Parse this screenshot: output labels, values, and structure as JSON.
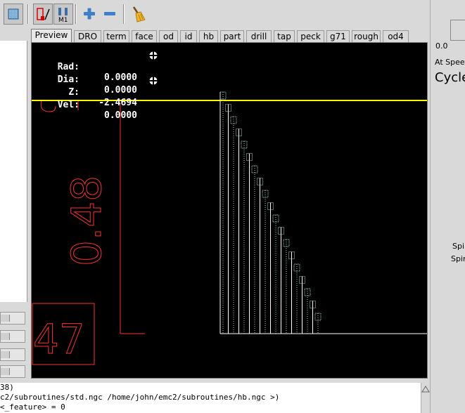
{
  "toolbar": {
    "buttons": [
      {
        "name": "estop-toggle",
        "icon": "estop-square-icon"
      },
      {
        "name": "optional-stop",
        "icon": "optional-stop-icon"
      },
      {
        "name": "machine-stop",
        "icon": "m1-icon",
        "label": "M1"
      },
      {
        "name": "zoom-in",
        "icon": "plus-icon"
      },
      {
        "name": "zoom-out",
        "icon": "minus-icon"
      },
      {
        "name": "clear-plot",
        "icon": "broom-icon"
      }
    ]
  },
  "tabs": [
    {
      "label": "Preview",
      "active": true
    },
    {
      "label": "DRO"
    },
    {
      "label": "term"
    },
    {
      "label": "face"
    },
    {
      "label": "od"
    },
    {
      "label": "id"
    },
    {
      "label": "hb"
    },
    {
      "label": "part"
    },
    {
      "label": "drill"
    },
    {
      "label": "tap"
    },
    {
      "label": "peck"
    },
    {
      "label": "g71"
    },
    {
      "label": "rough"
    },
    {
      "label": "od4"
    }
  ],
  "dro": [
    {
      "label": "Rad:",
      "value": "0.0000",
      "homed": true
    },
    {
      "label": "Dia:",
      "value": "0.0000",
      "homed": false
    },
    {
      "label": "Z:",
      "value": "-2.4694",
      "homed": true
    },
    {
      "label": "Vel:",
      "value": "0.0000",
      "homed": false
    }
  ],
  "preview": {
    "dimension_text": "0.48",
    "partial_dimension_text": "47",
    "colors": {
      "background": "#000000",
      "dimension": "#ff3030",
      "tool_line": "#ffff00",
      "path": "#ffffff",
      "feed": "#9ad0c0"
    }
  },
  "right_panel": {
    "gauge_value": "0.0",
    "at_speed_label": "At Spee",
    "cycle_label": "Cycle",
    "spindle_label_1": "Spi",
    "spindle_label_2": "Spir"
  },
  "console": {
    "lines": [
      "38)",
      "c2/subroutines/std.ngc /home/john/emc2/subroutines/hb.ngc >)",
      "<_feature> = 0"
    ]
  }
}
